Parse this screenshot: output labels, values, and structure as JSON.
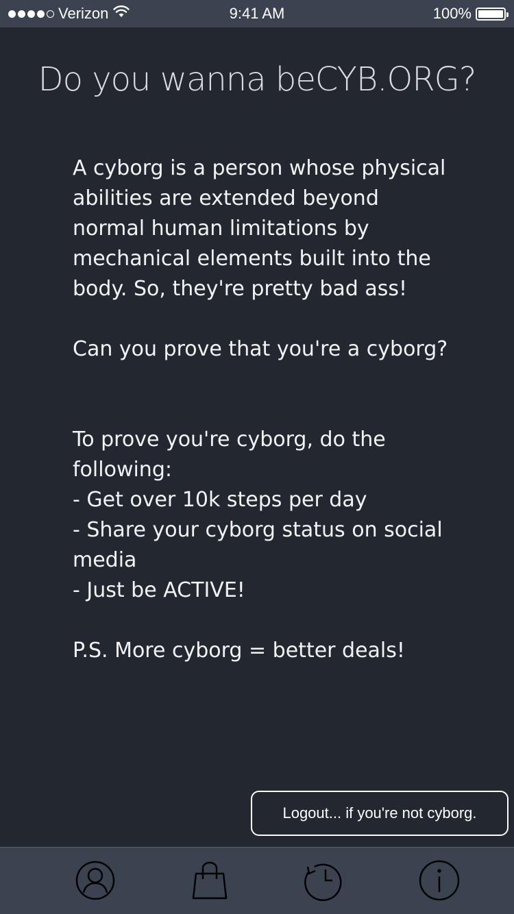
{
  "status_bar": {
    "carrier": "Verizon",
    "time": "9:41 AM",
    "battery": "100%",
    "signal_bars_filled": 4,
    "signal_bars_total": 5
  },
  "header": {
    "title": "Do you wanna beCYB.ORG?"
  },
  "main": {
    "description": "A cyborg is a person whose physical abilities are extended beyond normal human limitations by mechanical elements built into the body. So, they're pretty bad ass!\n\nCan you prove that you're a cyborg?\n\n\nTo prove you're cyborg, do the following:\n- Get over 10k steps per day\n- Share your cyborg status on social media\n- Just be ACTIVE!\n\nP.S. More cyborg = better deals!"
  },
  "actions": {
    "logout_label": "Logout... if you're not cyborg."
  },
  "tab_bar": {
    "items": [
      {
        "icon": "user-icon"
      },
      {
        "icon": "shopping-bag-icon"
      },
      {
        "icon": "history-icon"
      },
      {
        "icon": "info-icon"
      }
    ]
  },
  "colors": {
    "background": "#232730",
    "bars": "#3b4250",
    "text": "#ffffff",
    "title": "#d9dbe0"
  }
}
